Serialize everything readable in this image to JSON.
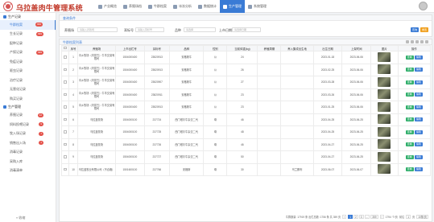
{
  "app": {
    "title": "乌拉盖肉牛管理系统"
  },
  "nav": [
    {
      "label": "产业概览",
      "active": false
    },
    {
      "label": "养殖场档",
      "active": false
    },
    {
      "label": "牛群档案",
      "active": false
    },
    {
      "label": "冰冻分析",
      "active": false
    },
    {
      "label": "数据统计",
      "active": false
    },
    {
      "label": "生产管理",
      "active": true
    },
    {
      "label": "系统管理",
      "active": false
    }
  ],
  "sidebar": {
    "section1": "生产记录",
    "items1": [
      {
        "label": "牛群档案",
        "badge": "999",
        "active": true
      },
      {
        "label": "生长记录",
        "badge": "999",
        "active": false
      },
      {
        "label": "配种记录",
        "badge": "",
        "active": false
      },
      {
        "label": "产犊记录",
        "badge": "999",
        "active": false
      },
      {
        "label": "免疫记录",
        "badge": "",
        "active": false
      },
      {
        "label": "驱虫记录",
        "badge": "",
        "active": false
      },
      {
        "label": "治疗记录",
        "badge": "",
        "active": false
      },
      {
        "label": "无害化记录",
        "badge": "",
        "active": false
      },
      {
        "label": "购买记录",
        "badge": "",
        "active": false
      }
    ],
    "section2": "生产管理",
    "items2": [
      {
        "label": "养殖记录",
        "badge": "12",
        "active": false
      },
      {
        "label": "饲料投喂记录",
        "badge": "9",
        "active": false
      },
      {
        "label": "牧入场记录",
        "badge": "7",
        "active": false
      },
      {
        "label": "销售出入场",
        "badge": "1",
        "active": false
      },
      {
        "label": "消毒记录",
        "badge": "",
        "active": false
      },
      {
        "label": "采购入库",
        "badge": "",
        "active": false
      },
      {
        "label": "消毒清单",
        "badge": "",
        "active": false
      }
    ],
    "collapse_label": "« 收缩"
  },
  "search": {
    "panel_title": "查询条件",
    "fields": [
      {
        "label": "养殖场",
        "placeholder": "请输入养殖场"
      },
      {
        "label": "耳标号",
        "placeholder": "请输入耳标号"
      },
      {
        "label": "品种",
        "placeholder": "请选择"
      },
      {
        "label": "上市日期",
        "placeholder": "请选择日期"
      }
    ],
    "query_label": "查询",
    "reset_label": "重置"
  },
  "table": {
    "panel_title": "牛群档案列表",
    "headers": [
      "序号",
      "养殖场",
      "上市出栏号",
      "耳标号",
      "品种",
      "性别",
      "当前体重(kg)",
      "养殖周期",
      "养入集成出生地",
      "出生日期",
      "上架时间",
      "图片",
      "操作"
    ],
    "rows": [
      [
        "1",
        "中乡牧场（内蒙古）牛羊交易有限司",
        "1504000400",
        "23820913",
        "安格斯牛",
        "公",
        "24",
        "",
        "",
        "2023-01-18",
        "2023-06-06"
      ],
      [
        "2",
        "中乡牧场（内蒙古）牛羊交易有限司",
        "1504000400",
        "23820913",
        "安格斯牛",
        "公",
        "26",
        "",
        "",
        "2023-02-25",
        "2023-06-06"
      ],
      [
        "3",
        "中乡牧场（内蒙古）牛羊交易有限司",
        "1504000400",
        "23820907",
        "安格斯牛",
        "公",
        "27",
        "",
        "",
        "2023-03-28",
        "2023-06-06"
      ],
      [
        "4",
        "中乡牧场（内蒙古）牛羊交易有限司",
        "1504000400",
        "23820911",
        "安格斯牛",
        "公",
        "23",
        "",
        "",
        "2023-03-26",
        "2023-06-06"
      ],
      [
        "5",
        "中乡牧场（内蒙古）牛羊交易有限司",
        "1504000400",
        "23820913",
        "安格斯牛",
        "公",
        "23",
        "",
        "",
        "2023-01-25",
        "2023-06-06"
      ],
      [
        "6",
        "乌拉盖牧场",
        "1504000100",
        "237724",
        "西门塔尔牛杂交二代",
        "母",
        "46",
        "",
        "",
        "2023-04-25",
        "2023-06-25"
      ],
      [
        "7",
        "乌拉盖牧场",
        "1504000100",
        "237725",
        "西门塔尔牛杂交二代",
        "母",
        "48",
        "",
        "",
        "2023-04-25",
        "2023-06-25"
      ],
      [
        "8",
        "乌拉盖牧场",
        "1504000100",
        "237726",
        "西门塔尔牛杂交二代",
        "母",
        "46",
        "",
        "",
        "2023-04-27",
        "2023-06-25"
      ],
      [
        "9",
        "乌拉盖牧场",
        "1504000100",
        "237727",
        "西门塔尔牛杂交二代",
        "母",
        "50",
        "",
        "",
        "2023-04-27",
        "2023-06-25"
      ],
      [
        "10",
        "乌拉盖牧业有限公司（不合格）",
        "1501600100",
        "237766",
        "安格斯",
        "母",
        "30",
        "",
        "乌兰察布",
        "2023-06-07",
        "2023-06-07"
      ]
    ],
    "op_view": "查看",
    "op_edit": "编辑"
  },
  "pager": {
    "summary": "牛群数量: 17919   条   出栏总数: 1756   条   共 359 页",
    "pages": [
      "1",
      "2",
      "3",
      "...",
      "359"
    ],
    "current_page": "1",
    "goto_label": "前往",
    "goto_value": "1",
    "page_suffix": "页",
    "per_page": "10条/页",
    "total": "1794 个/页"
  },
  "colors": {
    "accent": "#3a7bd5",
    "brand": "#c23a2b",
    "badge": "#e4534b",
    "op_view": "#2fae6a"
  },
  "icons": {
    "logo": "cow-logo-icon",
    "avatar": "user-avatar-icon"
  }
}
